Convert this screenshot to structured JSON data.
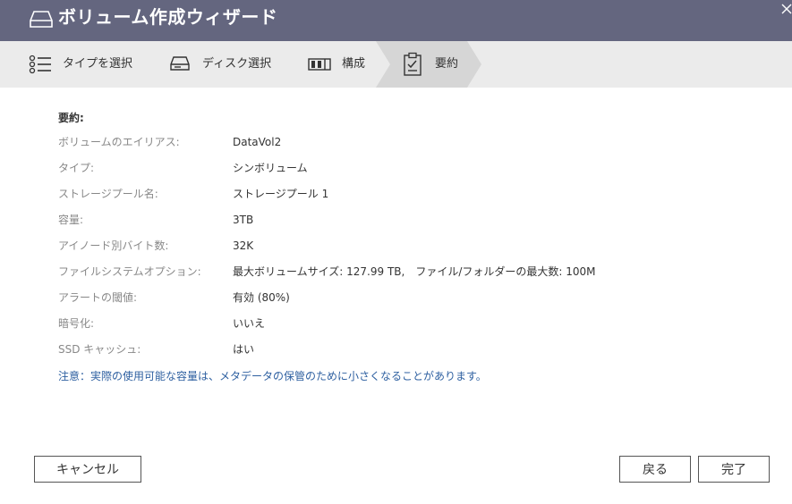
{
  "window": {
    "title": "ボリューム作成ウィザード"
  },
  "steps": [
    {
      "label": "タイプを選択",
      "icon": "list-icon",
      "active": false
    },
    {
      "label": "ディスク選択",
      "icon": "disk-icon",
      "active": false
    },
    {
      "label": "構成",
      "icon": "raid-icon",
      "active": false
    },
    {
      "label": "要約",
      "icon": "clipboard-check-icon",
      "active": true
    }
  ],
  "summary": {
    "heading": "要約:",
    "rows": [
      {
        "key": "ボリュームのエイリアス:",
        "value": "DataVol2"
      },
      {
        "key": "タイプ:",
        "value": "シンボリューム"
      },
      {
        "key": "ストレージプール名:",
        "value": "ストレージプール 1"
      },
      {
        "key": "容量:",
        "value": "3TB"
      },
      {
        "key": "アイノード別バイト数:",
        "value": "32K"
      },
      {
        "key": "ファイルシステムオプション:",
        "value": "最大ボリュームサイズ: 127.99 TB,　ファイル/フォルダーの最大数: 100M"
      },
      {
        "key": "アラートの閾値:",
        "value": "有効 (80%)"
      },
      {
        "key": "暗号化:",
        "value": "いいえ"
      },
      {
        "key": "SSD キャッシュ:",
        "value": "はい"
      }
    ],
    "note": "注意：実際の使用可能な容量は、メタデータの保管のために小さくなることがあります。"
  },
  "buttons": {
    "cancel": "キャンセル",
    "back": "戻る",
    "finish": "完了"
  },
  "colors": {
    "titlebar": "#64667f",
    "step_bar": "#ebebeb",
    "active_step": "#d6d6d6",
    "note": "#2d5fa0"
  }
}
